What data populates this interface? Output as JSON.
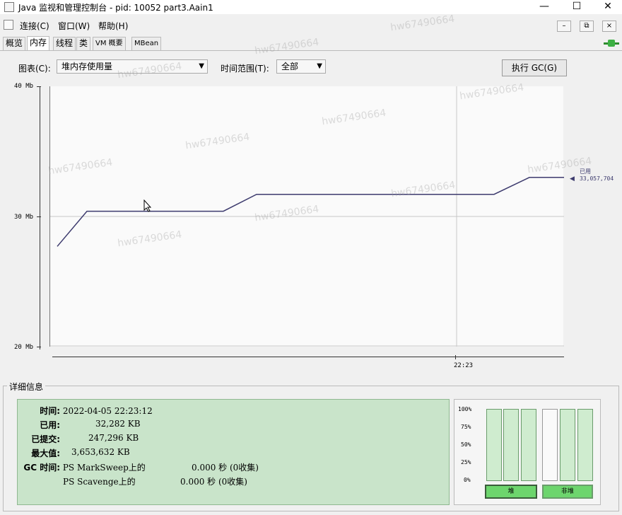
{
  "window": {
    "title": "Java 监视和管理控制台 - pid: 10052 part3.Aain1",
    "buttons": {
      "minimize": "—",
      "maximize": "☐",
      "close": "✕"
    }
  },
  "menu": {
    "items": [
      "连接(C)",
      "窗口(W)",
      "帮助(H)"
    ],
    "mdi": [
      "–",
      "⧉",
      "×"
    ]
  },
  "tabs": [
    "概览",
    "内存",
    "线程",
    "类",
    "VM 概要",
    "MBean"
  ],
  "active_tab": "内存",
  "controls": {
    "chart_label": "图表(C):",
    "chart_value": "堆内存使用量",
    "time_label": "时间范围(T):",
    "time_value": "全部",
    "gc_button": "执行 GC(G)"
  },
  "chart_data": {
    "type": "line",
    "y_ticks": [
      "40 Mb",
      "30 Mb",
      "20 Mb"
    ],
    "ylim_mb": [
      20,
      40
    ],
    "x_tick": "22:23",
    "series": [
      {
        "name": "已用",
        "color": "#3d3b6e",
        "points_mb": [
          27.7,
          30.4,
          30.4,
          31.7,
          31.7,
          33.0,
          33.0
        ]
      }
    ],
    "current_label": "已用",
    "current_value": "33,057,704"
  },
  "details": {
    "legend": "详细信息",
    "time_label": "时间:",
    "time_value": "2022-04-05 22:23:12",
    "used_label": "已用:",
    "used_value": "32,282 KB",
    "committed_label": "已提交:",
    "committed_value": "247,296 KB",
    "max_label": "最大值:",
    "max_value": "3,653,632 KB",
    "gc_label": "GC 时间:",
    "gc1_name": "PS MarkSweep上的",
    "gc1_value": "0.000 秒 (0收集)",
    "gc2_name": "PS Scavenge上的",
    "gc2_value": "0.000 秒 (0收集)"
  },
  "bars": {
    "pct_labels": [
      "100%",
      "75%",
      "50%",
      "25%",
      "0%"
    ],
    "heap_label": "堆",
    "nonheap_label": "非堆",
    "heap_fills": [
      0.0,
      0.02,
      0.0
    ],
    "nonheap_fills": [
      0.0,
      0.0,
      0.0
    ]
  },
  "watermark": "hw67490664",
  "colors": {
    "info_bg": "#c9e4ca",
    "bar_green": "#6dd56d",
    "line": "#3d3b6e"
  }
}
